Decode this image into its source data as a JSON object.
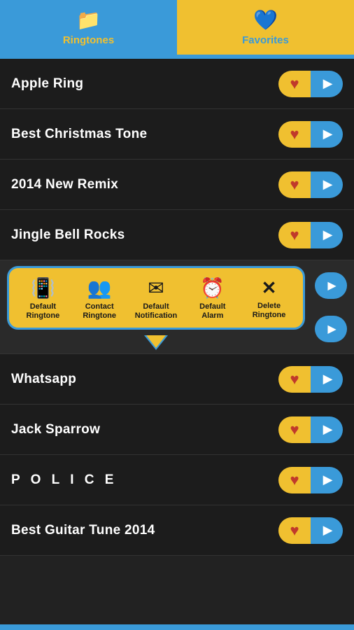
{
  "header": {
    "tabs": [
      {
        "id": "ringtones",
        "label": "Ringtones",
        "icon": "📁",
        "active": true
      },
      {
        "id": "favorites",
        "label": "Favorites",
        "icon": "💙",
        "active": false
      }
    ]
  },
  "ringtones": [
    {
      "id": 1,
      "name": "Apple Ring",
      "spaced": false
    },
    {
      "id": 2,
      "name": "Best Christmas Tone",
      "spaced": false
    },
    {
      "id": 3,
      "name": "2014 New Remix",
      "spaced": false
    },
    {
      "id": 4,
      "name": "Jingle Bell Rocks",
      "spaced": false
    }
  ],
  "popup": {
    "actions": [
      {
        "id": "default-ringtone",
        "icon": "📳",
        "label": "Default\nRingtone"
      },
      {
        "id": "contact-ringtone",
        "icon": "👥",
        "label": "Contact\nRingtone"
      },
      {
        "id": "default-notification",
        "icon": "✉",
        "label": "Default\nNotification"
      },
      {
        "id": "default-alarm",
        "icon": "⏰",
        "label": "Default\nAlarm"
      },
      {
        "id": "delete-ringtone",
        "icon": "✕",
        "label": "Delete\nRingtone"
      }
    ]
  },
  "ringtones_below": [
    {
      "id": 5,
      "name": "Whatsapp",
      "spaced": false
    },
    {
      "id": 6,
      "name": "Jack Sparrow",
      "spaced": false
    },
    {
      "id": 7,
      "name": "P O L I C E",
      "spaced": true
    },
    {
      "id": 8,
      "name": "Best Guitar Tune 2014",
      "spaced": false
    }
  ],
  "colors": {
    "accent_blue": "#3a9ad9",
    "accent_yellow": "#f0c030",
    "heart_red": "#c0392b",
    "bg_dark": "#1c1c1c",
    "text_white": "#ffffff"
  }
}
